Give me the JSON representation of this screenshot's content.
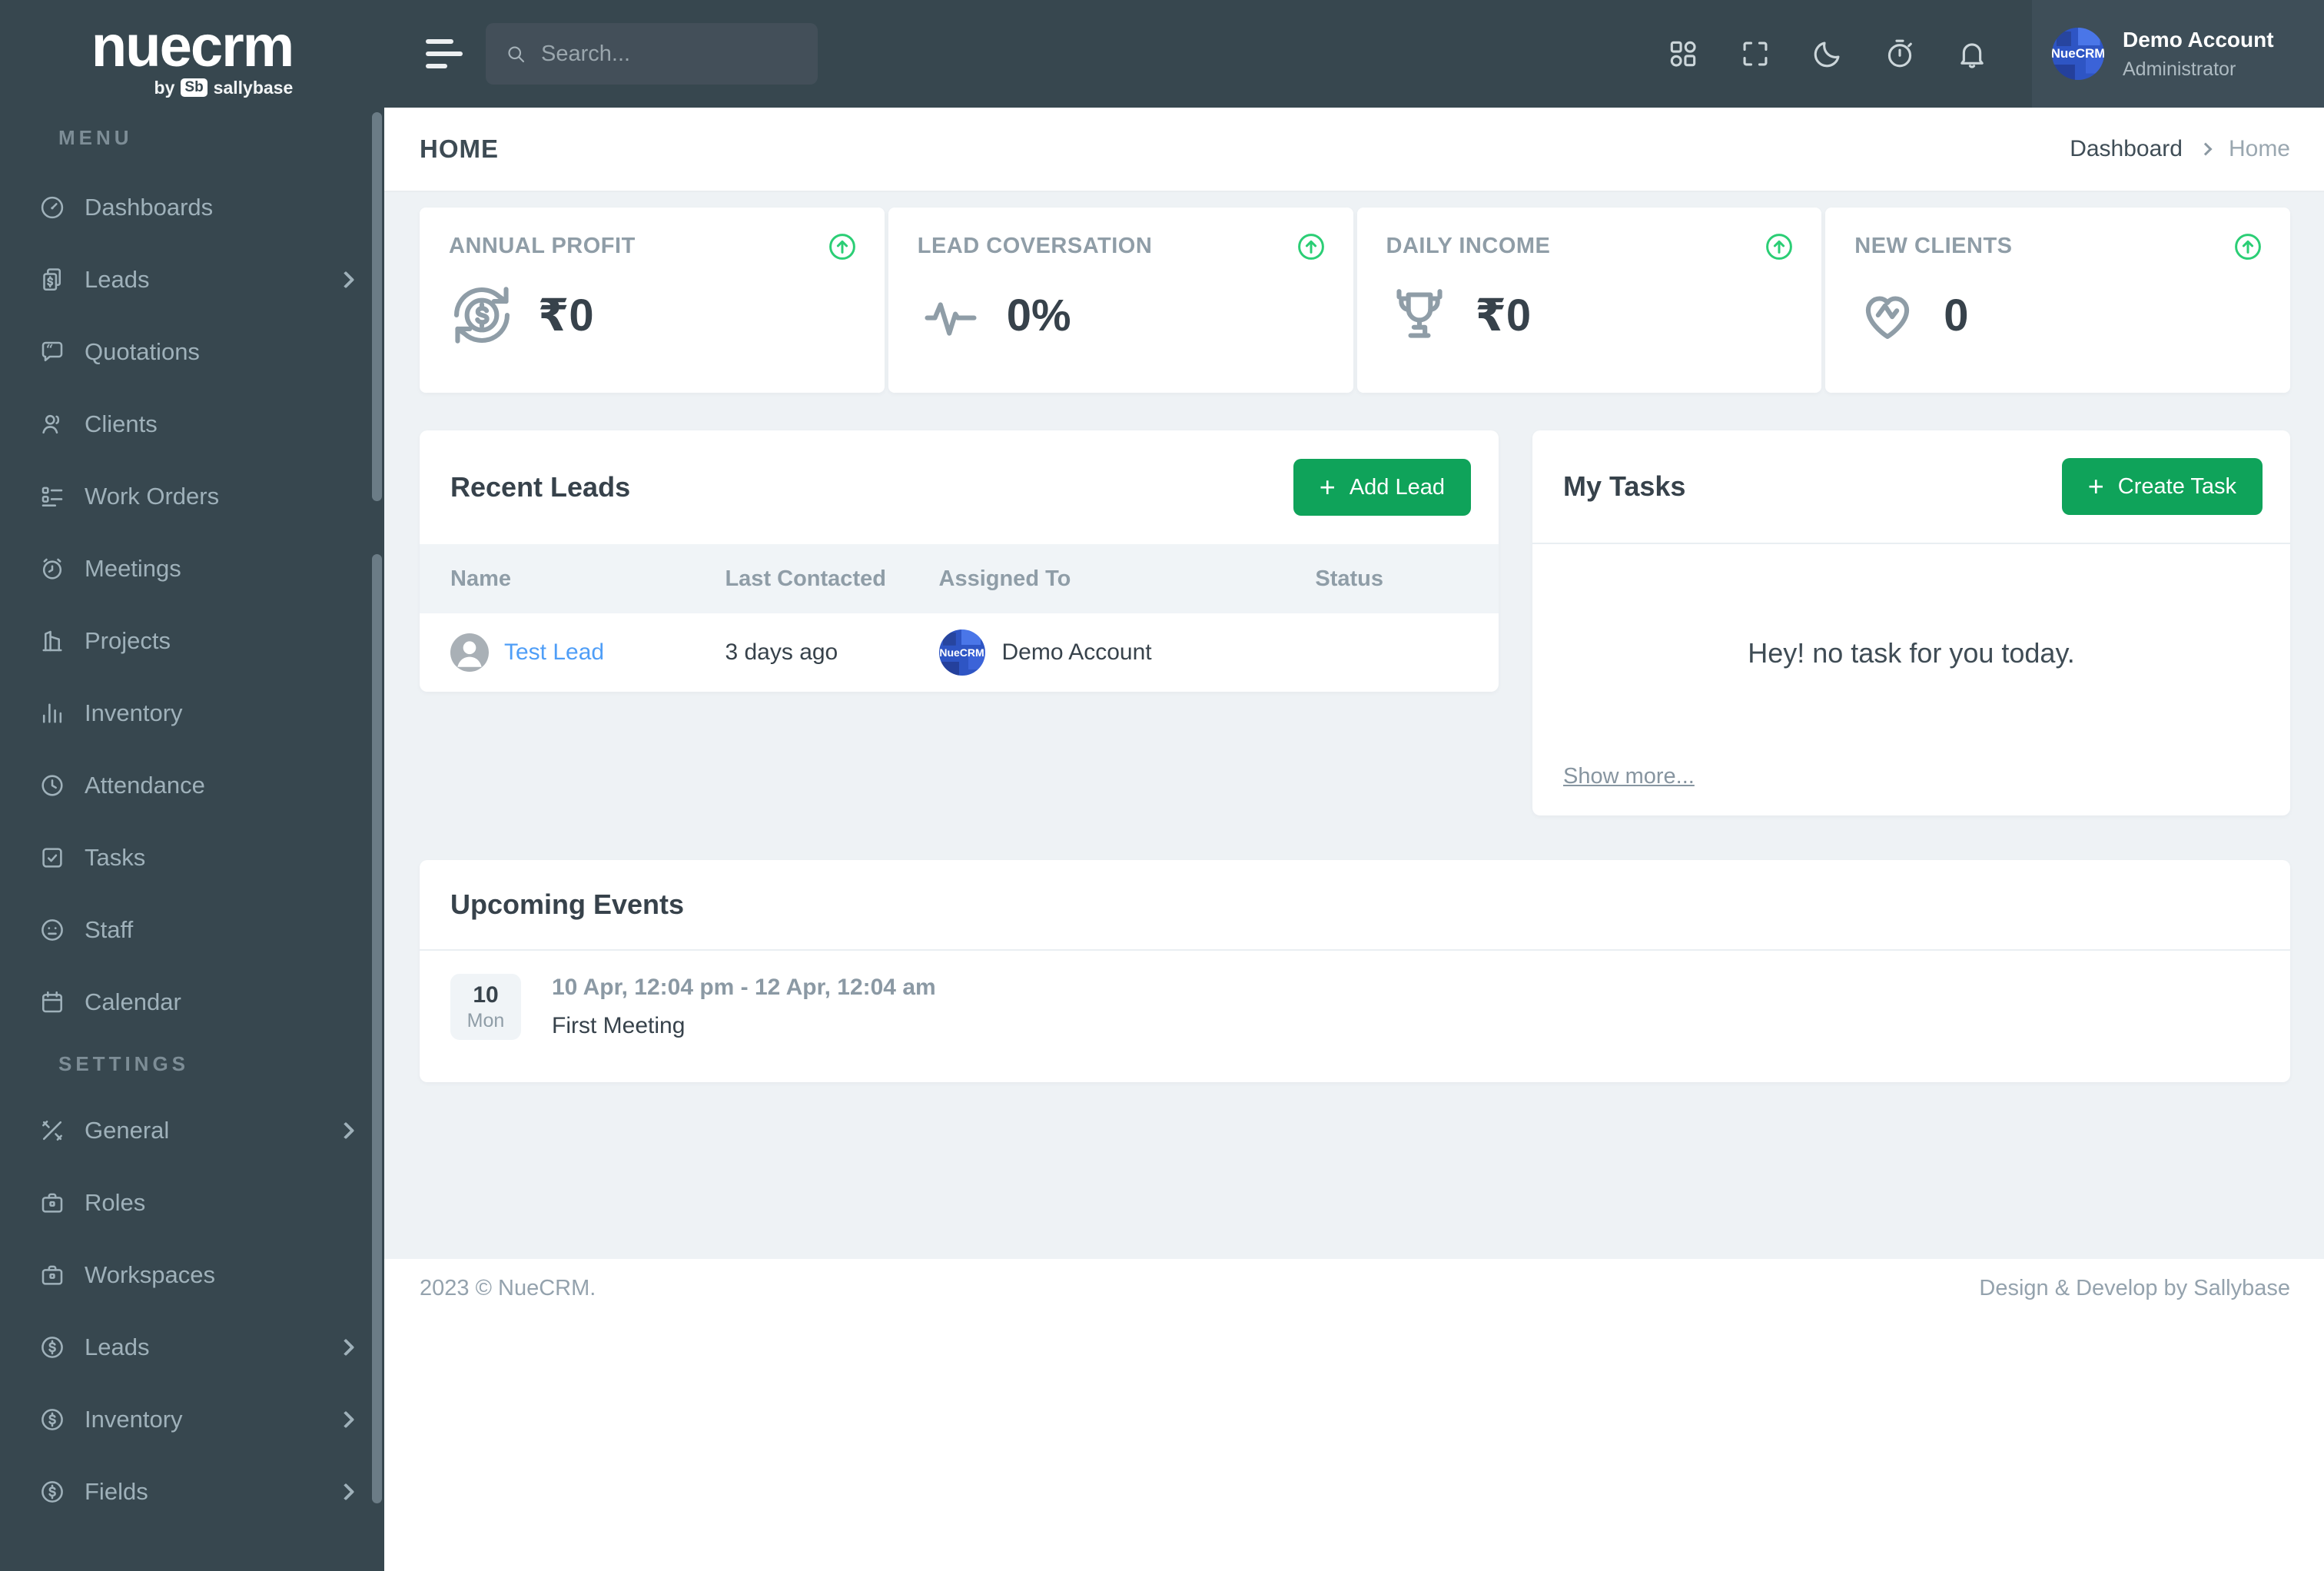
{
  "ui": {
    "plus": "+"
  },
  "brand": {
    "word": "nuecrm",
    "byline_prefix": "by",
    "badge": "Sb",
    "byline_brand": "sallybase"
  },
  "sidebar": {
    "menu_label": "MENU",
    "settings_label": "SETTINGS",
    "menu": [
      {
        "label": "Dashboards",
        "icon": "gauge-icon",
        "chevron": false
      },
      {
        "label": "Leads",
        "icon": "invoice-icon",
        "chevron": true
      },
      {
        "label": "Quotations",
        "icon": "quote-bubble-icon",
        "chevron": false
      },
      {
        "label": "Clients",
        "icon": "user-icon",
        "chevron": false
      },
      {
        "label": "Work Orders",
        "icon": "list-icon",
        "chevron": false
      },
      {
        "label": "Meetings",
        "icon": "alarm-icon",
        "chevron": false
      },
      {
        "label": "Projects",
        "icon": "building-icon",
        "chevron": false
      },
      {
        "label": "Inventory",
        "icon": "bar-chart-icon",
        "chevron": false
      },
      {
        "label": "Attendance",
        "icon": "clock-icon",
        "chevron": false
      },
      {
        "label": "Tasks",
        "icon": "task-check-icon",
        "chevron": false
      },
      {
        "label": "Staff",
        "icon": "face-icon",
        "chevron": false
      },
      {
        "label": "Calendar",
        "icon": "calendar-icon",
        "chevron": false
      }
    ],
    "settings": [
      {
        "label": "General",
        "icon": "tools-icon",
        "chevron": true
      },
      {
        "label": "Roles",
        "icon": "briefcase-icon",
        "chevron": false
      },
      {
        "label": "Workspaces",
        "icon": "briefcase-icon",
        "chevron": false
      },
      {
        "label": "Leads",
        "icon": "dollar-circle-icon",
        "chevron": true
      },
      {
        "label": "Inventory",
        "icon": "dollar-circle-icon",
        "chevron": true
      },
      {
        "label": "Fields",
        "icon": "dollar-circle-icon",
        "chevron": true
      }
    ]
  },
  "topbar": {
    "search_placeholder": "Search...",
    "icons": [
      "apps-grid-icon",
      "fullscreen-icon",
      "moon-icon",
      "stopwatch-icon",
      "bell-icon"
    ],
    "user": {
      "name": "Demo Account",
      "role": "Administrator",
      "avatar_text": "NueCRM"
    }
  },
  "titlebar": {
    "title": "HOME",
    "breadcrumb_root": "Dashboard",
    "breadcrumb_current": "Home"
  },
  "stats": [
    {
      "label": "ANNUAL PROFIT",
      "value": "₹0",
      "icon": "currency-cycle-icon"
    },
    {
      "label": "LEAD COVERSATION",
      "value": "0%",
      "icon": "pulse-icon"
    },
    {
      "label": "DAILY INCOME",
      "value": "₹0",
      "icon": "trophy-icon"
    },
    {
      "label": "NEW CLIENTS",
      "value": "0",
      "icon": "heart-icon"
    }
  ],
  "recent_leads": {
    "title": "Recent Leads",
    "add_button": "Add Lead",
    "columns": [
      "Name",
      "Last Contacted",
      "Assigned To",
      "Status"
    ],
    "rows": [
      {
        "name": "Test Lead",
        "last_contacted": "3 days ago",
        "assigned_to": "Demo Account",
        "assigned_avatar_text": "NueCRM",
        "status": ""
      }
    ]
  },
  "my_tasks": {
    "title": "My Tasks",
    "create_button": "Create Task",
    "empty_message": "Hey! no task for you today.",
    "show_more": "Show more..."
  },
  "upcoming_events": {
    "title": "Upcoming Events",
    "events": [
      {
        "day": "10",
        "weekday": "Mon",
        "time_range": "10 Apr, 12:04 pm - 12 Apr, 12:04 am",
        "title": "First Meeting"
      }
    ]
  },
  "footer": {
    "left": "2023 © NueCRM.",
    "right": "Design & Develop by Sallybase"
  },
  "colors": {
    "sidebar_bg": "#37474f",
    "content_bg": "#eef2f5",
    "button_green": "#0fa35a",
    "indicator_green": "#2bce75",
    "link_blue": "#4f9ef7"
  }
}
